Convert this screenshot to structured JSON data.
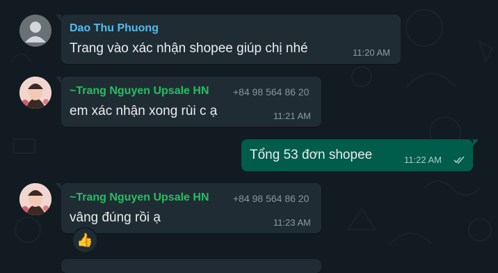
{
  "messages": [
    {
      "sender": "Dao Thu Phuong",
      "sender_color": "#53bdeb",
      "text": "Trang vào xác nhận shopee giúp chị nhé",
      "time": "11:20 AM"
    },
    {
      "sender": "~Trang Nguyen Upsale HN",
      "sender_color": "#21c063",
      "phone": "+84 98 564 86 20",
      "text": "em xác nhận xong rùi c ạ",
      "time": "11:21 AM"
    },
    {
      "text": "Tổng 53 đơn shopee",
      "time": "11:22 AM",
      "status": "read-double-check"
    },
    {
      "sender": "~Trang Nguyen Upsale HN",
      "sender_color": "#21c063",
      "phone": "+84 98 564 86 20",
      "text": "vâng đúng rồi ạ",
      "time": "11:23 AM",
      "reaction": "👍"
    }
  ],
  "colors": {
    "background": "#121b22",
    "incoming_bubble": "#202c33",
    "outgoing_bubble": "#005c4b"
  }
}
